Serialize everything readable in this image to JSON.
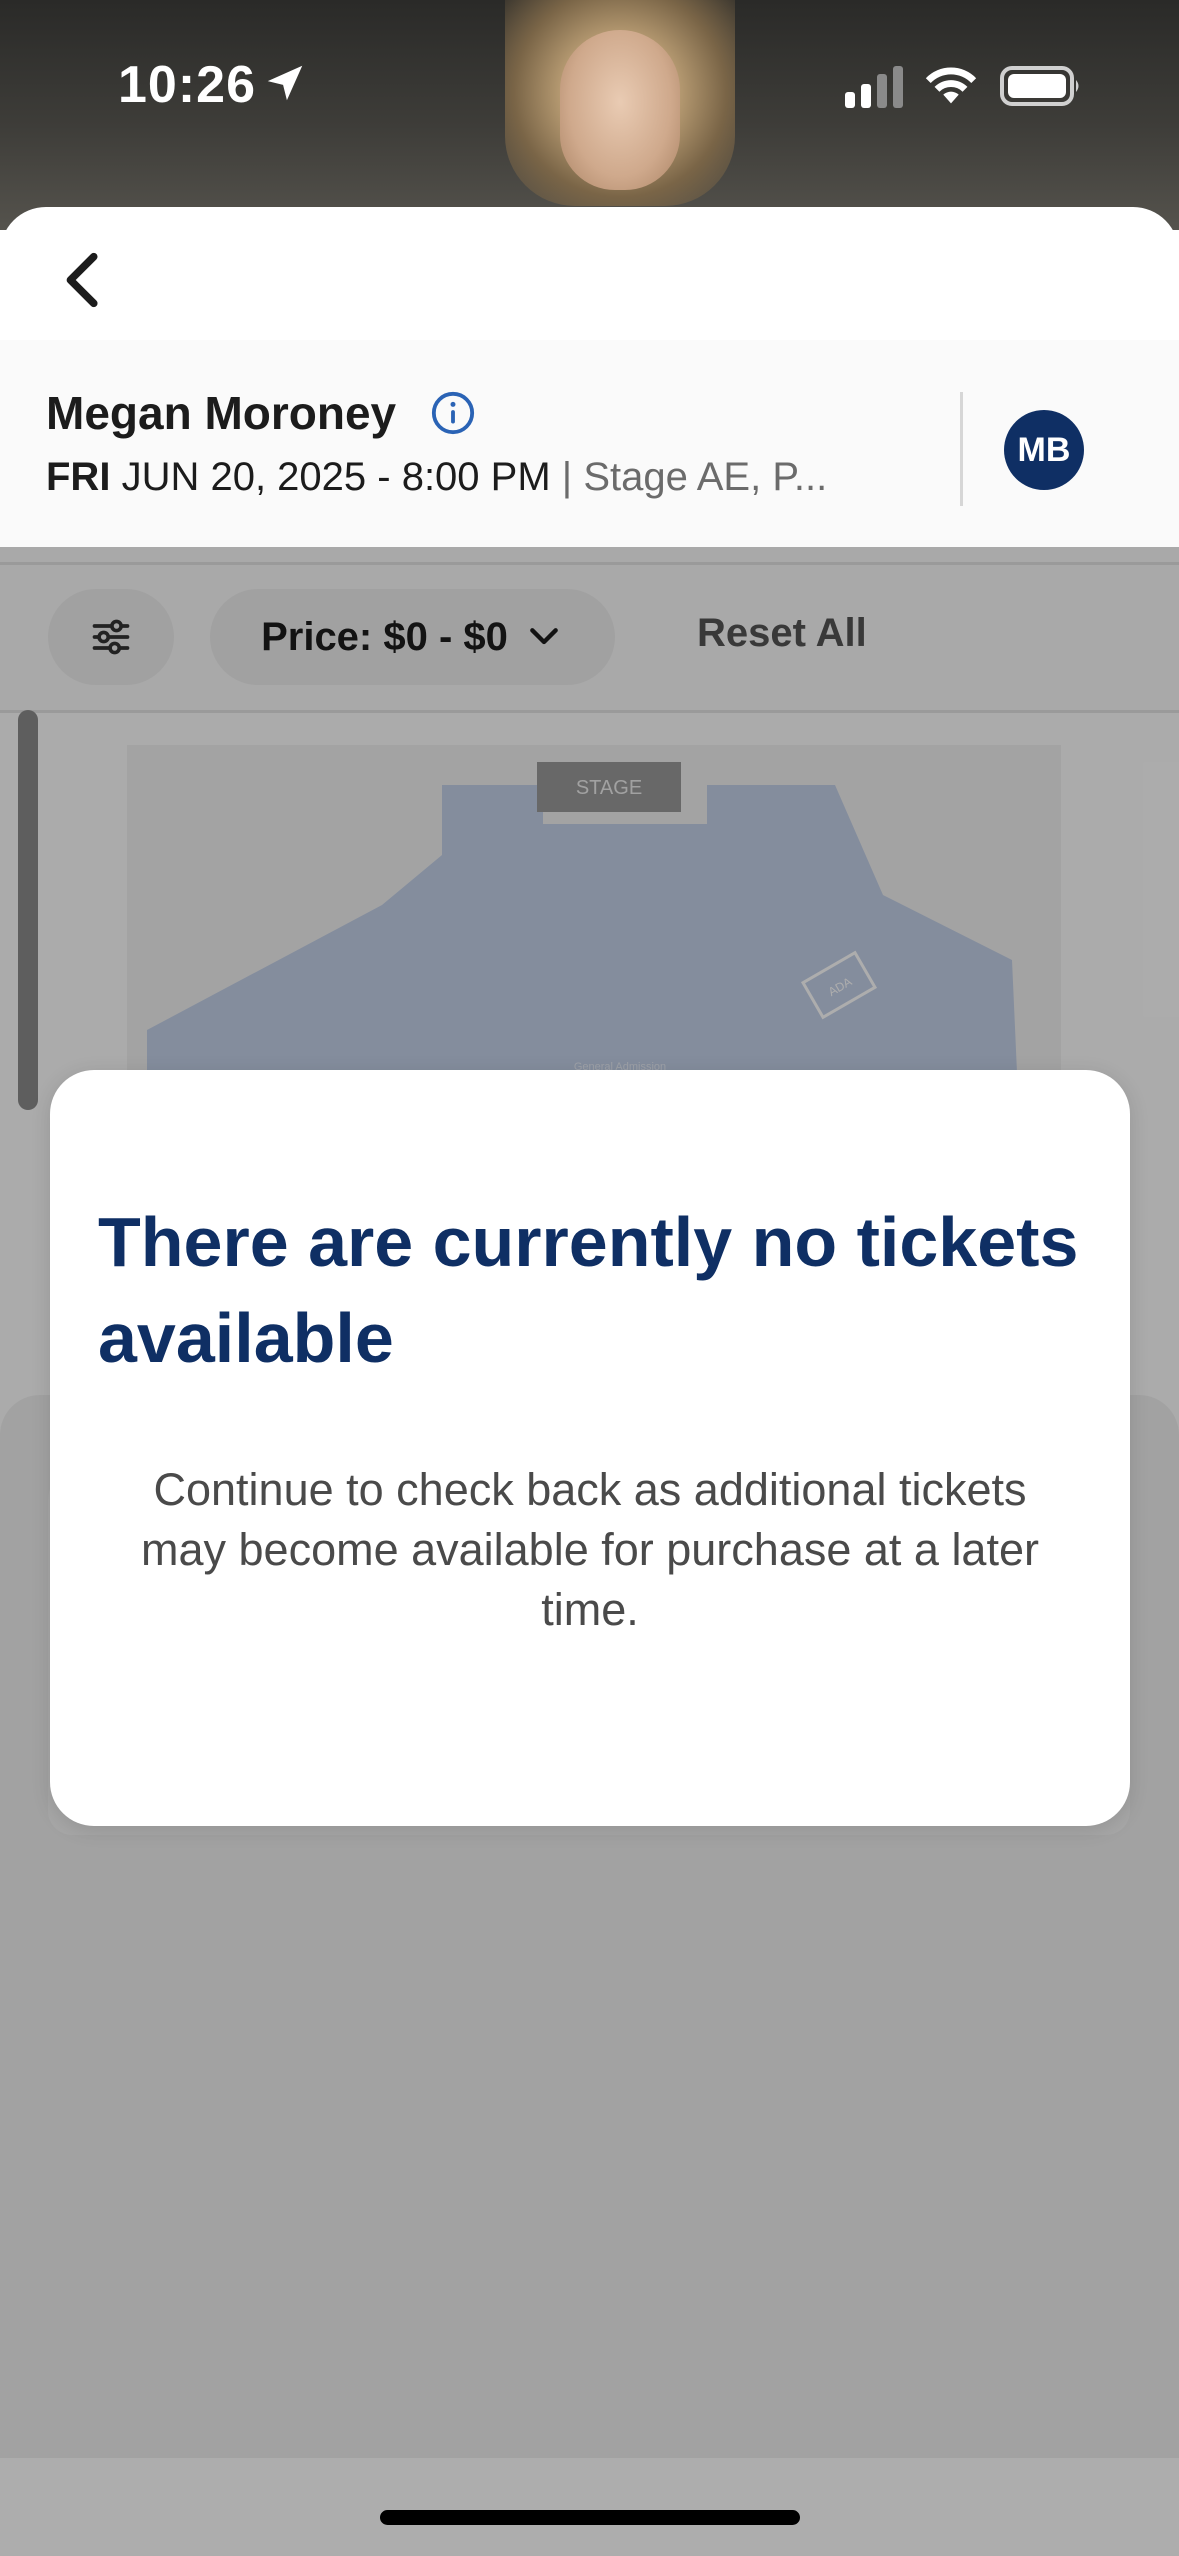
{
  "status_bar": {
    "time": "10:26"
  },
  "event": {
    "artist": "Megan Moroney",
    "day": "FRI",
    "date_time": "JUN 20, 2025 - 8:00 PM",
    "separator": "|",
    "venue": "Stage AE, P...",
    "avatar_initials": "MB"
  },
  "filters": {
    "price_label": "Price: $0 - $0",
    "reset_label": "Reset All"
  },
  "map": {
    "stage_label": "STAGE",
    "ada_label": "ADA",
    "ga_label": "General Admission"
  },
  "modal": {
    "title": "There are currently no tickets available",
    "body": "Continue to check back as additional tickets may become available for purchase at a later time."
  },
  "colors": {
    "brand_navy": "#0f2f64",
    "info_blue": "#2a63b5",
    "map_section": "#c3d0e8"
  }
}
